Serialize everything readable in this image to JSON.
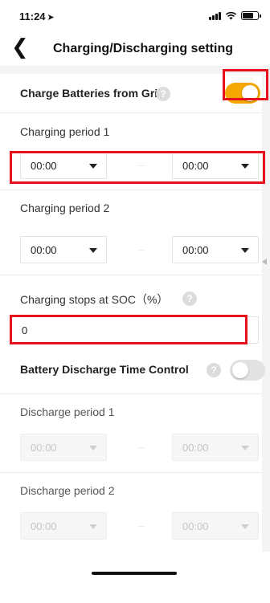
{
  "status": {
    "time": "11:24",
    "location_glyph": "➤"
  },
  "nav": {
    "title": "Charging/Discharging setting",
    "back": "❮"
  },
  "charge": {
    "title": "Charge Batteries from Grid",
    "help": "?",
    "toggle_on": true,
    "period1": {
      "label": "Charging period 1",
      "start": "00:00",
      "end": "00:00"
    },
    "period2": {
      "label": "Charging period 2",
      "start": "00:00",
      "end": "00:00"
    },
    "soc": {
      "label": "Charging stops at SOC（%）",
      "help": "?",
      "value": "0"
    }
  },
  "discharge": {
    "title": "Battery Discharge Time Control",
    "help": "?",
    "toggle_on": false,
    "period1": {
      "label": "Discharge period 1",
      "start": "00:00",
      "end": "00:00"
    },
    "period2": {
      "label": "Discharge period 2",
      "start": "00:00",
      "end": "00:00"
    }
  },
  "colors": {
    "accent": "#f5a700",
    "highlight": "#e8101a",
    "background": "#f4f4f4"
  }
}
